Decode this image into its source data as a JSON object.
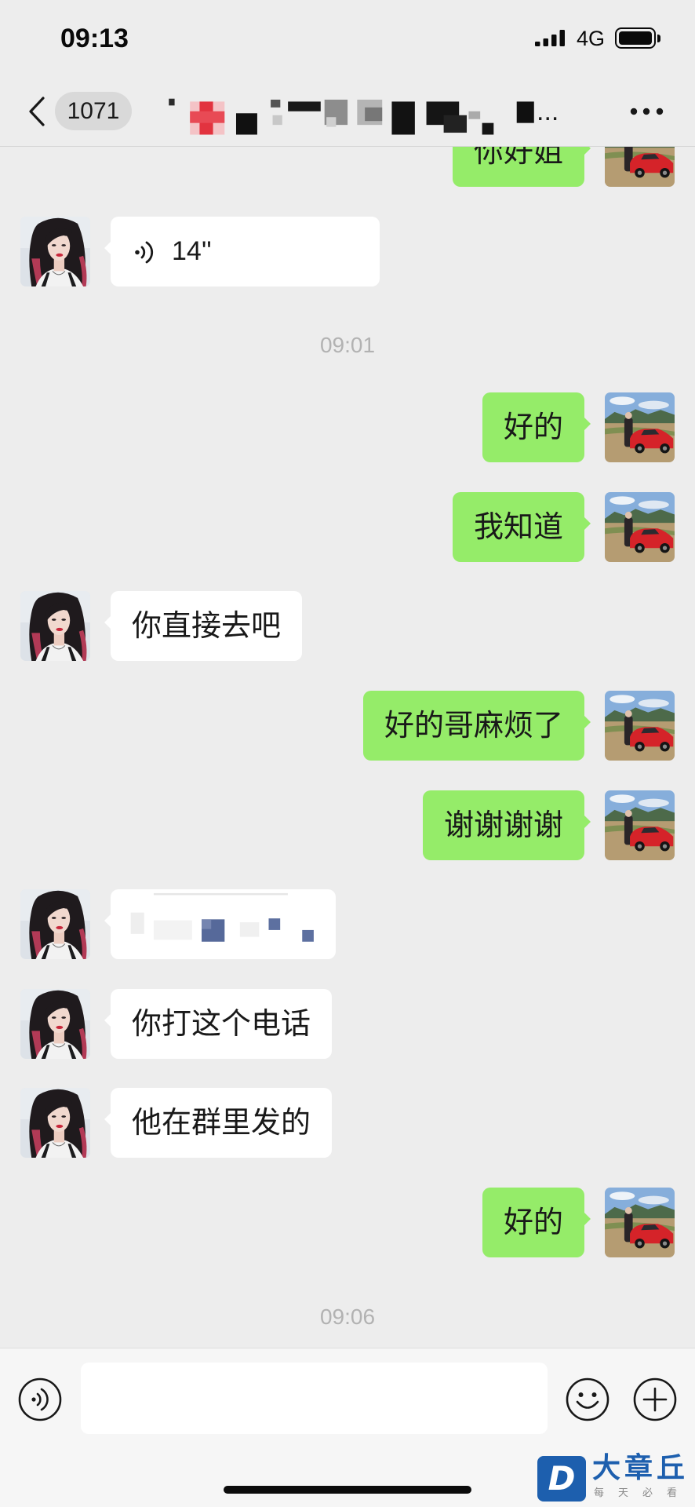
{
  "status_bar": {
    "time": "09:13",
    "network": "4G",
    "signal_icon": "signal-bars-icon",
    "battery_icon": "battery-full-icon"
  },
  "header": {
    "back_icon": "chevron-left-icon",
    "unread_count": "1071",
    "title_visible": "...",
    "more_icon": "more-dots-icon"
  },
  "chat": {
    "rows": [
      {
        "text": "你好姐"
      },
      {
        "voice_duration": "14''",
        "icon": "voice-wave-icon"
      },
      {
        "time": "09:01"
      },
      {
        "text": "好的"
      },
      {
        "text": "我知道"
      },
      {
        "text": "你直接去吧"
      },
      {
        "text": "好的哥麻烦了"
      },
      {
        "text": "谢谢谢谢"
      },
      {
        "redacted": true
      },
      {
        "text": "你打这个电话"
      },
      {
        "text": "他在群里发的"
      },
      {
        "text": "好的"
      },
      {
        "time": "09:06"
      }
    ]
  },
  "input_bar": {
    "voice_icon": "voice-mode-icon",
    "text_value": "",
    "emoji_icon": "emoji-icon",
    "plus_icon": "plus-circle-icon"
  },
  "watermark": {
    "logo_letter": "D",
    "brand": "大章丘",
    "tagline": "每天必看"
  },
  "colors": {
    "chat_background": "#ededed",
    "outgoing_bubble": "#95ec69",
    "incoming_bubble": "#ffffff",
    "timestamp": "#b2b2b2",
    "brand_blue": "#1d5fae"
  }
}
